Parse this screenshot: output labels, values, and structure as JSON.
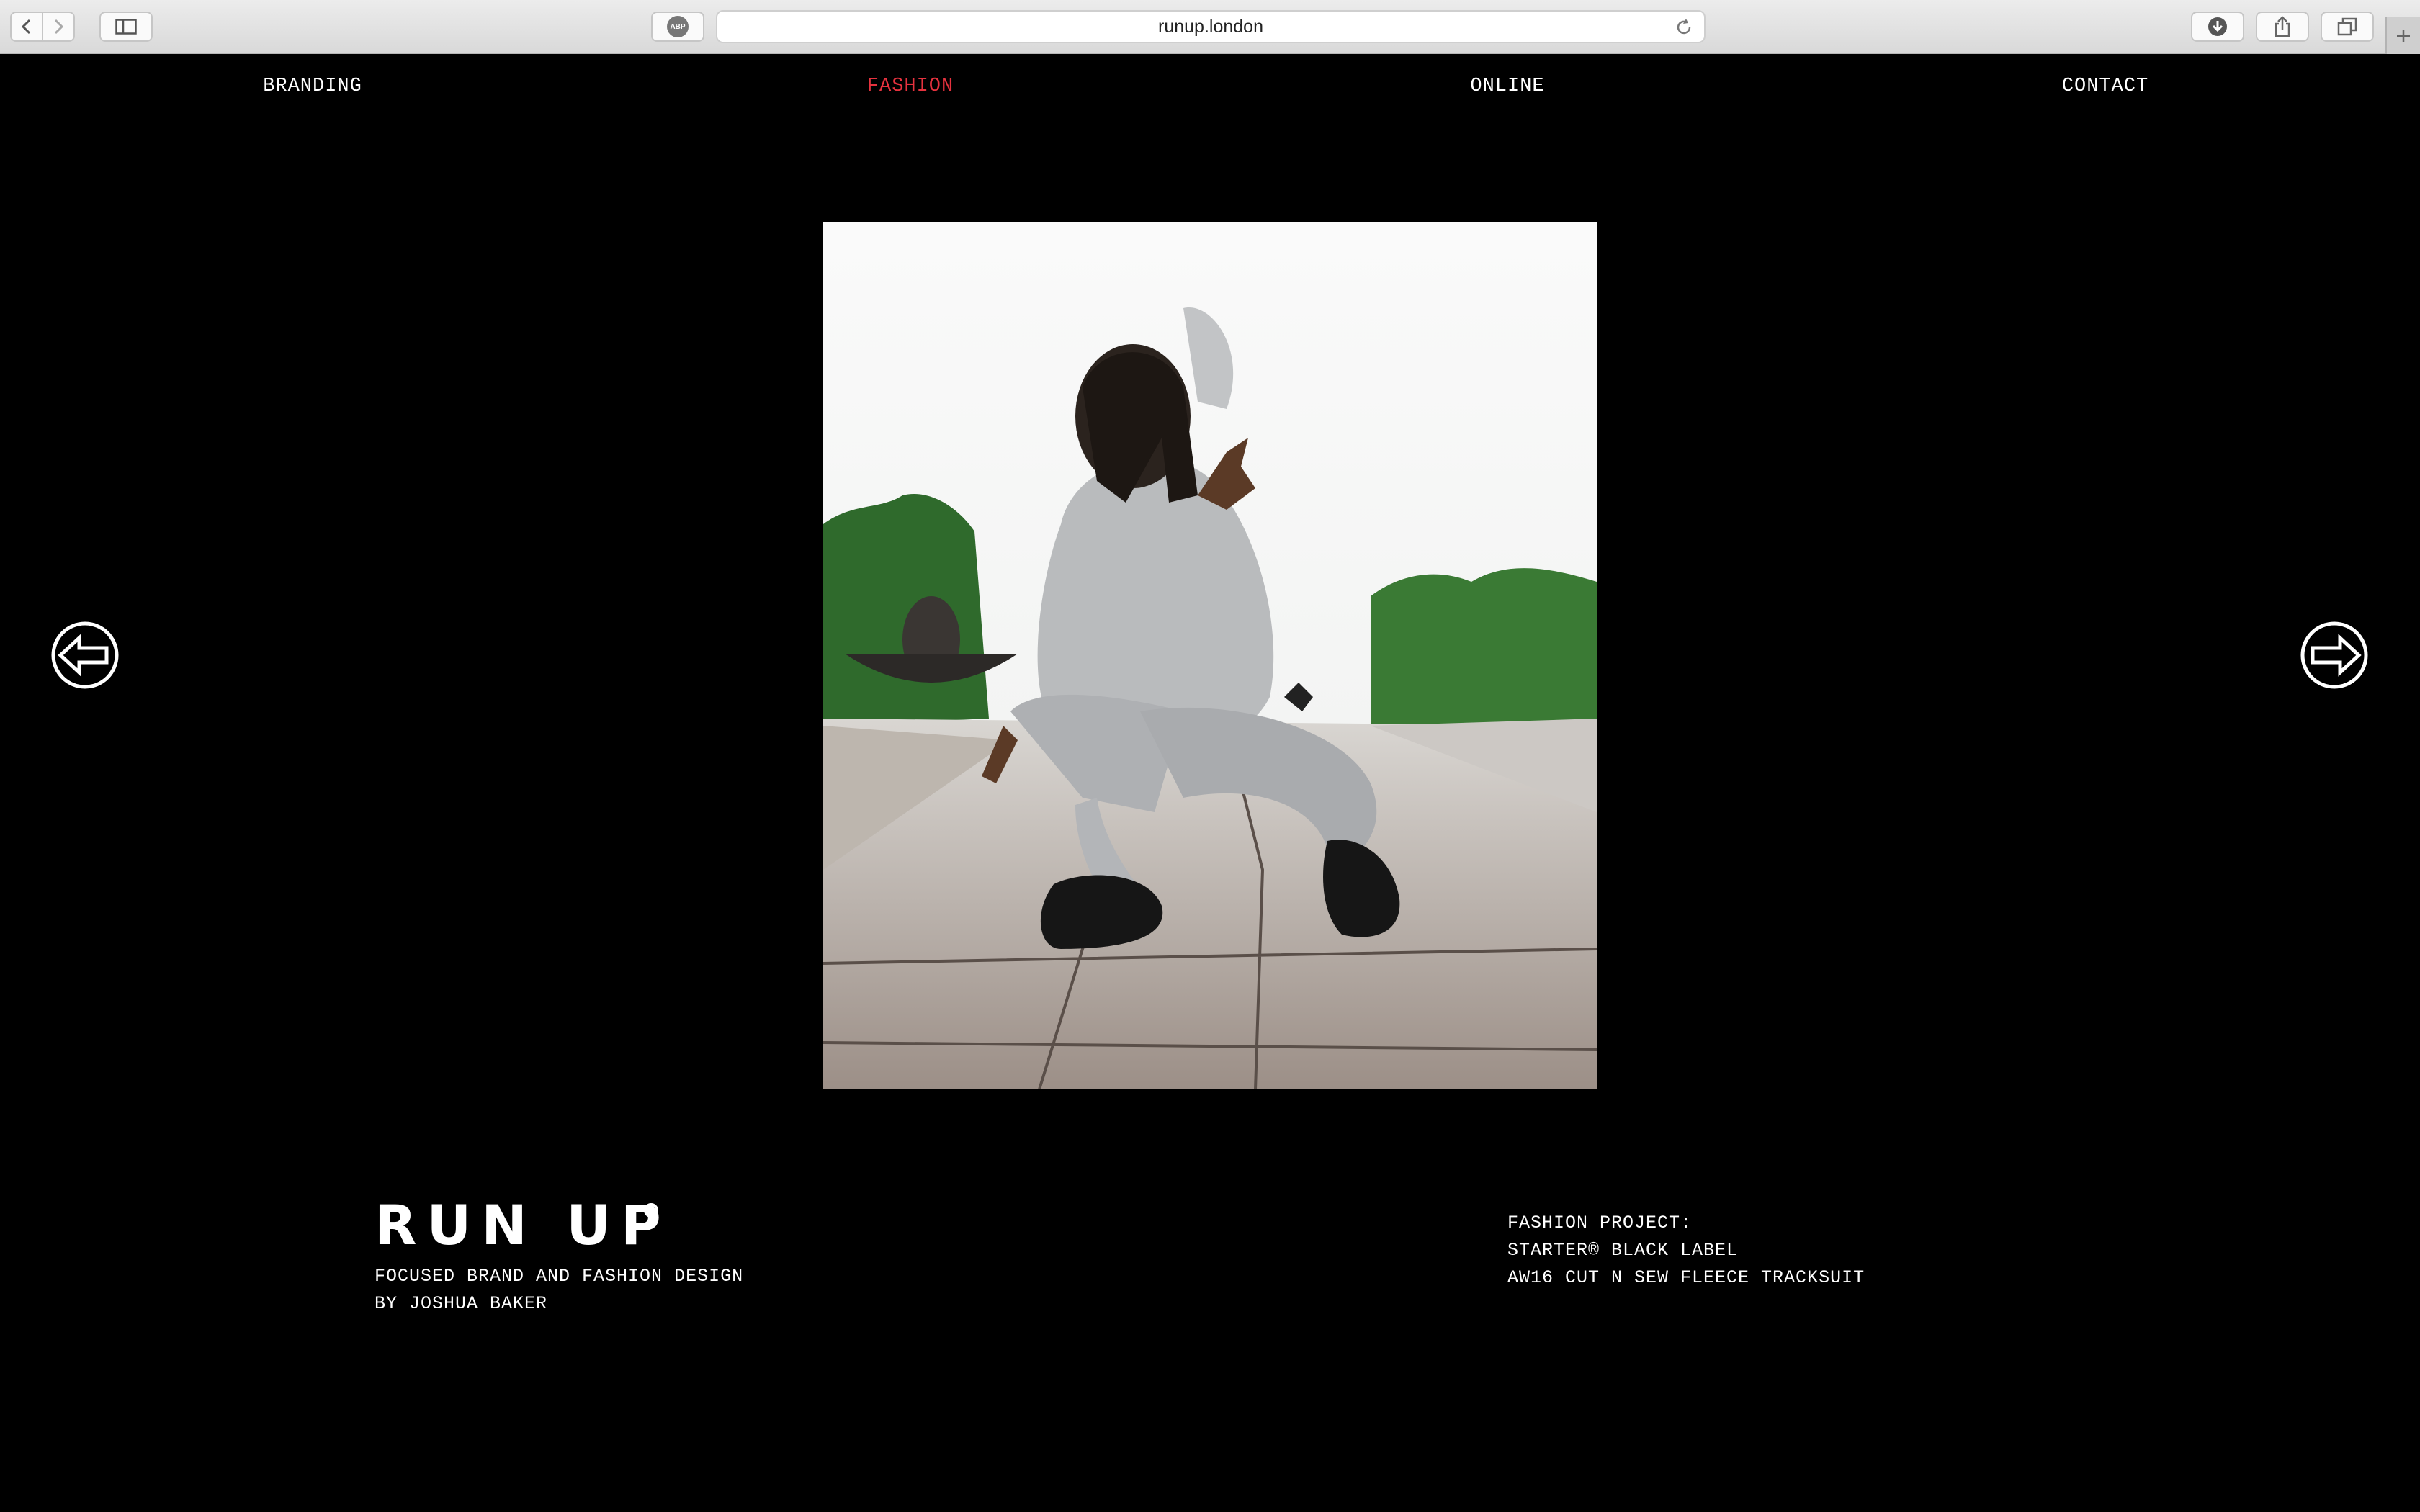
{
  "browser": {
    "url": "runup.london",
    "buttons": {
      "back": "back-arrow-icon",
      "forward": "forward-arrow-icon",
      "sidebar": "sidebar-icon",
      "adblock_label": "ABP",
      "reload": "reload-icon",
      "download": "download-icon",
      "share": "share-icon",
      "tabs": "tabs-icon",
      "new_tab": "plus-icon"
    }
  },
  "nav": {
    "items": [
      {
        "label": "BRANDING",
        "active": false
      },
      {
        "label": "FASHION",
        "active": true
      },
      {
        "label": "ONLINE",
        "active": false
      },
      {
        "label": "CONTACT",
        "active": false
      }
    ],
    "active_color": "#e6323e"
  },
  "gallery": {
    "prev_icon": "left-arrow-circle-icon",
    "next_icon": "right-arrow-circle-icon",
    "image_icon": "fashion-photo"
  },
  "brand": {
    "logo": "RUN UP",
    "tagline": [
      "FOCUSED BRAND AND FASHION DESIGN",
      "BY JOSHUA BAKER"
    ]
  },
  "project": {
    "lines": [
      "FASHION PROJECT:",
      "STARTER® BLACK LABEL",
      "AW16 CUT N SEW FLEECE TRACKSUIT"
    ]
  }
}
